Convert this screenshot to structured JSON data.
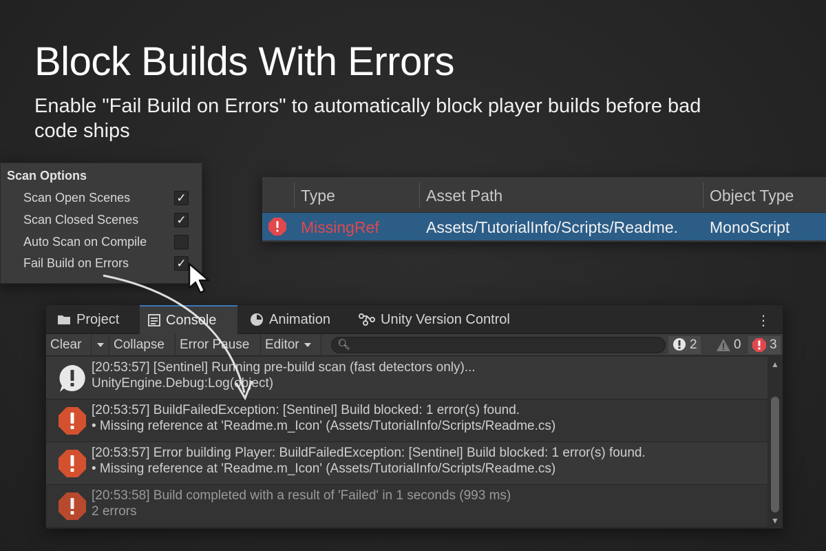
{
  "headline": "Block Builds With Errors",
  "subline": "Enable \"Fail Build on Errors\" to automatically block player builds before bad code ships",
  "scan_options": {
    "title": "Scan Options",
    "items": [
      {
        "label": "Scan Open Scenes",
        "checked": true
      },
      {
        "label": "Scan Closed Scenes",
        "checked": true
      },
      {
        "label": "Auto Scan on Compile",
        "checked": false
      },
      {
        "label": "Fail Build on Errors",
        "checked": true
      }
    ]
  },
  "issues_table": {
    "columns": [
      "Type",
      "Asset Path",
      "Object Type"
    ],
    "rows": [
      {
        "type": "MissingRef",
        "asset_path": "Assets/TutorialInfo/Scripts/Readme.",
        "object_type": "MonoScript"
      }
    ]
  },
  "console": {
    "tabs": [
      {
        "label": "Project",
        "icon": "folder-icon"
      },
      {
        "label": "Console",
        "icon": "console-icon"
      },
      {
        "label": "Animation",
        "icon": "animation-clock-icon"
      },
      {
        "label": "Unity Version Control",
        "icon": "version-control-icon"
      }
    ],
    "toolbar": {
      "clear": "Clear",
      "collapse": "Collapse",
      "error_pause": "Error Pause",
      "editor": "Editor",
      "search_value": ""
    },
    "counts": {
      "info": "2",
      "warning": "0",
      "error": "3"
    },
    "logs": [
      {
        "severity": "info",
        "line1": "[20:53:57] [Sentinel] Running pre-build scan (fast detectors only)...",
        "line2": "UnityEngine.Debug:Log(object)"
      },
      {
        "severity": "error",
        "line1": "[20:53:57] BuildFailedException: [Sentinel] Build blocked: 1 error(s) found.",
        "line2": "  • Missing reference at 'Readme.m_Icon' (Assets/TutorialInfo/Scripts/Readme.cs)"
      },
      {
        "severity": "error",
        "line1": "[20:53:57] Error building Player: BuildFailedException: [Sentinel] Build blocked: 1 error(s) found.",
        "line2": "  • Missing reference at 'Readme.m_Icon' (Assets/TutorialInfo/Scripts/Readme.cs)"
      },
      {
        "severity": "error",
        "line1": "[20:53:58] Build completed with a result of 'Failed' in 1 seconds (993 ms)",
        "line2": "2 errors"
      }
    ]
  },
  "colors": {
    "background": "#262626",
    "error_red": "#e0484e",
    "selection_blue": "#2c5d87",
    "tab_accent": "#3a79bb"
  }
}
